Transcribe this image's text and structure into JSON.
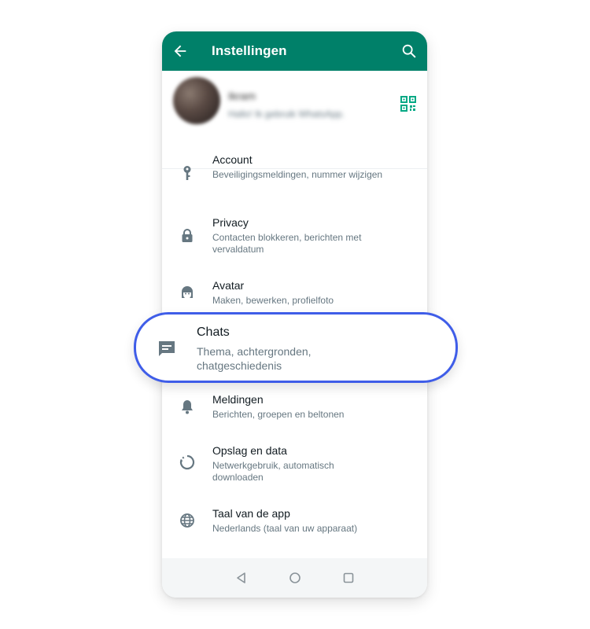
{
  "appbar": {
    "title": "Instellingen",
    "back_icon": "arrow-left-icon",
    "search_icon": "search-icon"
  },
  "profile": {
    "name": "Ikram",
    "status": "Hallo! Ik gebruik WhatsApp.",
    "qr_icon": "qr-code-icon"
  },
  "settings": [
    {
      "title": "Account",
      "subtitle": "Beveiligingsmeldingen, nummer wijzigen",
      "icon": "key-icon"
    },
    {
      "title": "Privacy",
      "subtitle": "Contacten blokkeren, berichten met vervaldatum",
      "icon": "lock-icon"
    },
    {
      "title": "Avatar",
      "subtitle": "Maken, bewerken, profielfoto",
      "icon": "avatar-icon"
    },
    {
      "title": "Chats",
      "subtitle": "Thema, achtergronden, chatgeschiedenis",
      "icon": "chat-icon",
      "highlighted": true
    },
    {
      "title": "Meldingen",
      "subtitle": "Berichten, groepen en beltonen",
      "icon": "bell-icon"
    },
    {
      "title": "Opslag en data",
      "subtitle": "Netwerkgebruik, automatisch downloaden",
      "icon": "storage-icon"
    },
    {
      "title": "Taal van de app",
      "subtitle": "Nederlands (taal van uw apparaat)",
      "icon": "globe-icon"
    }
  ],
  "navbar": {
    "back": "nav-back-icon",
    "home": "nav-home-icon",
    "recents": "nav-recents-icon"
  },
  "colors": {
    "appbar": "#008069",
    "accent": "#00a884",
    "highlight_border": "#3f5de8",
    "icon_grey": "#667781"
  }
}
